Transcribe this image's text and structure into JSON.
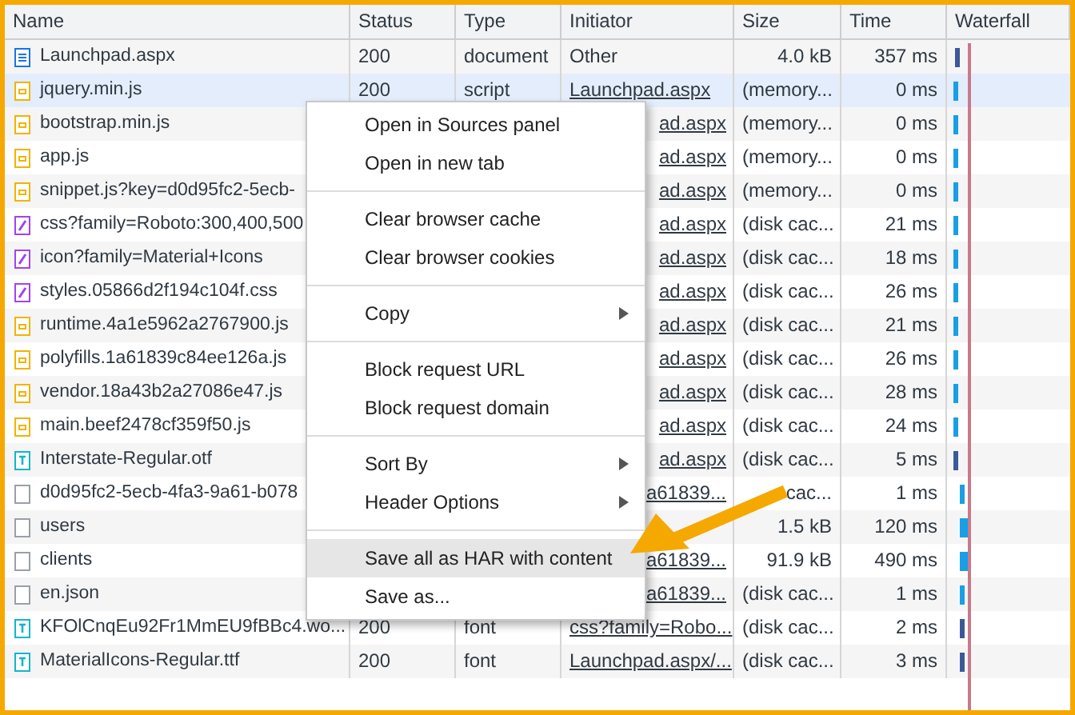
{
  "table": {
    "columns": [
      "Name",
      "Status",
      "Type",
      "Initiator",
      "Size",
      "Time",
      "Waterfall"
    ],
    "rows": [
      {
        "kind": "document",
        "name": "Launchpad.aspx",
        "status": "200",
        "type": "document",
        "initiator": "Other",
        "initiator_link": false,
        "size": "4.0 kB",
        "time": "357 ms",
        "selected": false
      },
      {
        "kind": "script",
        "name": "jquery.min.js",
        "status": "200",
        "type": "script",
        "initiator": "Launchpad.aspx",
        "initiator_link": true,
        "size": "(memory...",
        "time": "0 ms",
        "selected": true
      },
      {
        "kind": "script",
        "name": "bootstrap.min.js",
        "initiator": "ad.aspx",
        "initiator_link": true,
        "size": "(memory...",
        "time": "0 ms",
        "selected": false
      },
      {
        "kind": "script",
        "name": "app.js",
        "initiator": "ad.aspx",
        "initiator_link": true,
        "size": "(memory...",
        "time": "0 ms",
        "selected": false
      },
      {
        "kind": "script",
        "name": "snippet.js?key=d0d95fc2-5ecb-",
        "initiator": "ad.aspx",
        "initiator_link": true,
        "size": "(memory...",
        "time": "0 ms",
        "selected": false
      },
      {
        "kind": "stylesheet",
        "name": "css?family=Roboto:300,400,500",
        "initiator": "ad.aspx",
        "initiator_link": true,
        "size": "(disk cac...",
        "time": "21 ms",
        "selected": false
      },
      {
        "kind": "stylesheet",
        "name": "icon?family=Material+Icons",
        "initiator": "ad.aspx",
        "initiator_link": true,
        "size": "(disk cac...",
        "time": "18 ms",
        "selected": false
      },
      {
        "kind": "stylesheet",
        "name": "styles.05866d2f194c104f.css",
        "initiator": "ad.aspx",
        "initiator_link": true,
        "size": "(disk cac...",
        "time": "26 ms",
        "selected": false
      },
      {
        "kind": "script",
        "name": "runtime.4a1e5962a2767900.js",
        "initiator": "ad.aspx",
        "initiator_link": true,
        "size": "(disk cac...",
        "time": "21 ms",
        "selected": false
      },
      {
        "kind": "script",
        "name": "polyfills.1a61839c84ee126a.js",
        "initiator": "ad.aspx",
        "initiator_link": true,
        "size": "(disk cac...",
        "time": "26 ms",
        "selected": false
      },
      {
        "kind": "script",
        "name": "vendor.18a43b2a27086e47.js",
        "initiator": "ad.aspx",
        "initiator_link": true,
        "size": "(disk cac...",
        "time": "28 ms",
        "selected": false
      },
      {
        "kind": "script",
        "name": "main.beef2478cf359f50.js",
        "initiator": "ad.aspx",
        "initiator_link": true,
        "size": "(disk cac...",
        "time": "24 ms",
        "selected": false
      },
      {
        "kind": "font",
        "name": "Interstate-Regular.otf",
        "initiator": "ad.aspx",
        "initiator_link": true,
        "size": "(disk cac...",
        "time": "5 ms",
        "selected": false
      },
      {
        "kind": "other",
        "name": "d0d95fc2-5ecb-4fa3-9a61-b078",
        "initiator": "a61839...",
        "initiator_link": true,
        "size": "cac...",
        "time": "1 ms",
        "selected": false
      },
      {
        "kind": "other",
        "name": "users",
        "size": "1.5 kB",
        "time": "120 ms",
        "selected": false
      },
      {
        "kind": "other",
        "name": "clients",
        "initiator": "a61839...",
        "initiator_link": true,
        "size": "91.9 kB",
        "time": "490 ms",
        "selected": false
      },
      {
        "kind": "other",
        "name": "en.json",
        "initiator": "a61839...",
        "initiator_link": true,
        "size": "(disk cac...",
        "time": "1 ms",
        "selected": false
      },
      {
        "kind": "font",
        "name": "KFOlCnqEu92Fr1MmEU9fBBc4.wo...",
        "status": "200",
        "type": "font",
        "initiator": "css?family=Robo...",
        "initiator_link": true,
        "size": "(disk cac...",
        "time": "2 ms",
        "selected": false
      },
      {
        "kind": "font",
        "name": "MaterialIcons-Regular.ttf",
        "status": "200",
        "type": "font",
        "initiator": "Launchpad.aspx/...",
        "initiator_link": true,
        "size": "(disk cac...",
        "time": "3 ms",
        "selected": false
      }
    ]
  },
  "context_menu": {
    "groups": [
      [
        {
          "label": "Open in Sources panel",
          "submenu": false,
          "highlighted": false
        },
        {
          "label": "Open in new tab",
          "submenu": false,
          "highlighted": false
        }
      ],
      [
        {
          "label": "Clear browser cache",
          "submenu": false,
          "highlighted": false
        },
        {
          "label": "Clear browser cookies",
          "submenu": false,
          "highlighted": false
        }
      ],
      [
        {
          "label": "Copy",
          "submenu": true,
          "highlighted": false
        }
      ],
      [
        {
          "label": "Block request URL",
          "submenu": false,
          "highlighted": false
        },
        {
          "label": "Block request domain",
          "submenu": false,
          "highlighted": false
        }
      ],
      [
        {
          "label": "Sort By",
          "submenu": true,
          "highlighted": false
        },
        {
          "label": "Header Options",
          "submenu": true,
          "highlighted": false
        }
      ],
      [
        {
          "label": "Save all as HAR with content",
          "submenu": false,
          "highlighted": true
        },
        {
          "label": "Save as...",
          "submenu": false,
          "highlighted": false
        }
      ]
    ]
  }
}
